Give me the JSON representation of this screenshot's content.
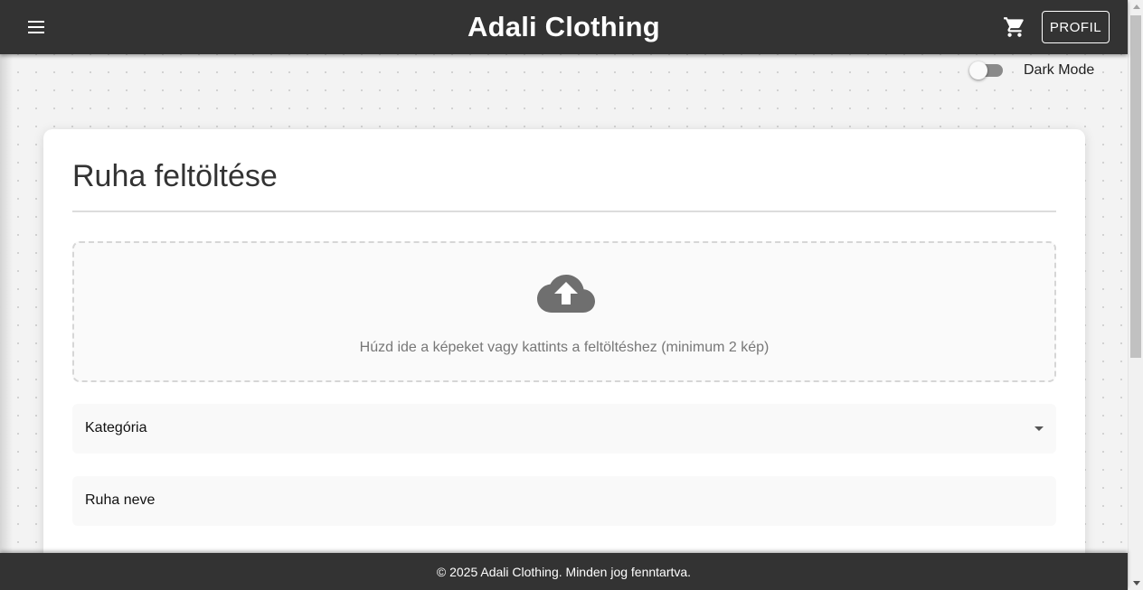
{
  "navbar": {
    "brand": "Adali Clothing",
    "menu_icon": "hamburger-menu-icon",
    "cart_icon": "shopping-cart-icon",
    "profile_label": "PROFIL"
  },
  "dark_mode": {
    "label": "Dark Mode",
    "enabled": false
  },
  "upload_form": {
    "title": "Ruha feltöltése",
    "dropzone": {
      "icon": "cloud-upload-icon",
      "text": "Húzd ide a képeket vagy kattints a feltöltéshez (minimum 2 kép)"
    },
    "fields": {
      "category_label": "Kategória",
      "name_label": "Ruha neve"
    }
  },
  "footer": {
    "text": "© 2025 Adali Clothing. Minden jog fenntartva."
  },
  "colors": {
    "navbar_bg": "#333333",
    "page_bg": "#f3f3f3",
    "card_bg": "#ffffff",
    "icon_gray": "#6f6f6f"
  }
}
